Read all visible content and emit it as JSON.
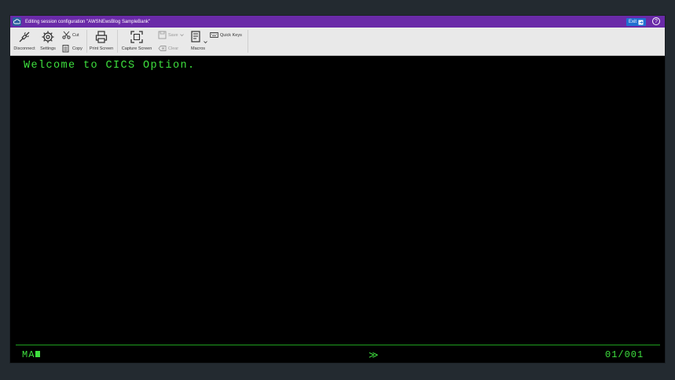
{
  "titlebar": {
    "title": "Editing session configuration \"AWSNEwsBlog SampleBank\"",
    "exit_label": "Exit",
    "help_label": "?"
  },
  "toolbar": {
    "disconnect": "Disconnect",
    "settings": "Settings",
    "cut": "Cut",
    "copy": "Copy",
    "print_screen": "Print Screen",
    "capture_screen": "Capture Screen",
    "save": "Save",
    "clear": "Clear",
    "macros": "Macros",
    "quick_keys": "Quick Keys"
  },
  "terminal": {
    "welcome_text": "Welcome to CICS Option.",
    "oia_left": "MA",
    "oia_middle": "≫",
    "oia_right": "01/001",
    "text_color": "#3ee03e"
  },
  "colors": {
    "titlebar": "#6a2aa8",
    "exit_button": "#1f6fd1",
    "background": "#232a30"
  }
}
